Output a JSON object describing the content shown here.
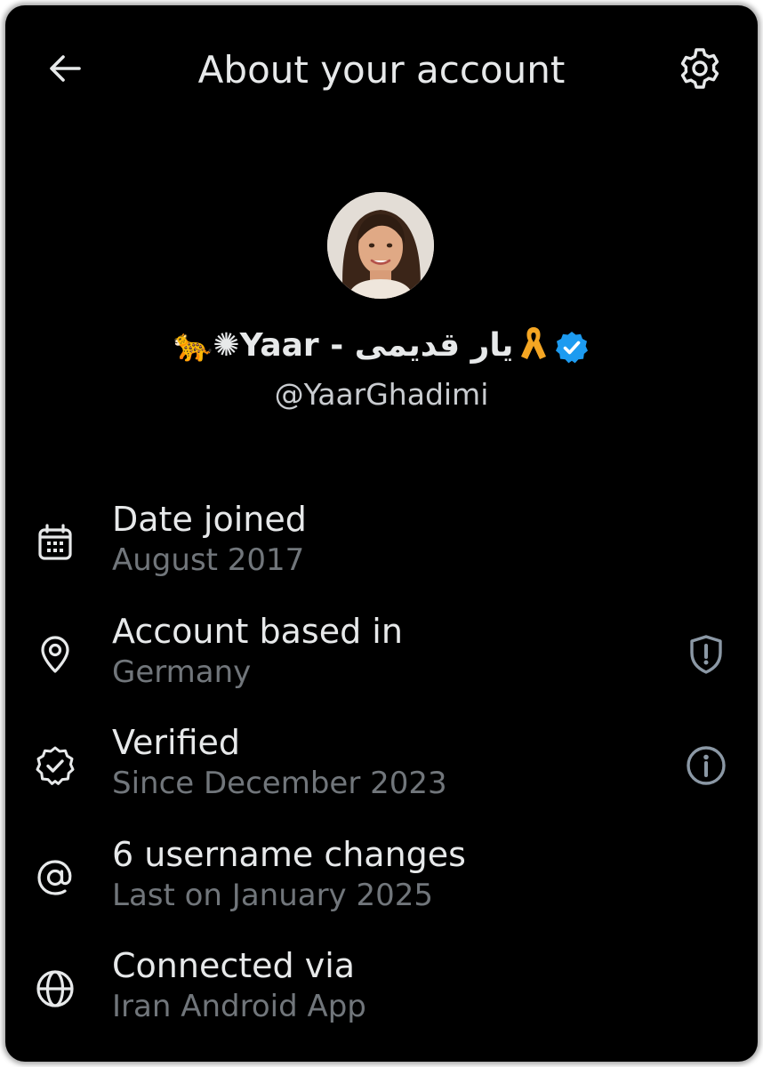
{
  "header": {
    "title": "About your account",
    "back_icon": "arrow-left-icon",
    "settings_icon": "gear-icon"
  },
  "profile": {
    "display_name": "🐆✺Yaar - یار قدیمی",
    "name_emoji_icon": "yellow-ribbon-icon",
    "verified_icon": "verified-badge-icon",
    "handle": "@YaarGhadimi",
    "accent_color": "#1d9bf0",
    "ribbon_color": "#f5a623"
  },
  "details": [
    {
      "icon": "calendar-icon",
      "title": "Date joined",
      "subtitle": "August 2017",
      "action_icon": ""
    },
    {
      "icon": "location-pin-icon",
      "title": "Account based in",
      "subtitle": "Germany",
      "action_icon": "shield-alert-icon"
    },
    {
      "icon": "verified-outline-icon",
      "title": "Verified",
      "subtitle": "Since December 2023",
      "action_icon": "info-icon"
    },
    {
      "icon": "at-sign-icon",
      "title": "6 username changes",
      "subtitle": "Last on January 2025",
      "action_icon": ""
    },
    {
      "icon": "globe-icon",
      "title": "Connected via",
      "subtitle": "Iran Android App",
      "action_icon": ""
    }
  ]
}
